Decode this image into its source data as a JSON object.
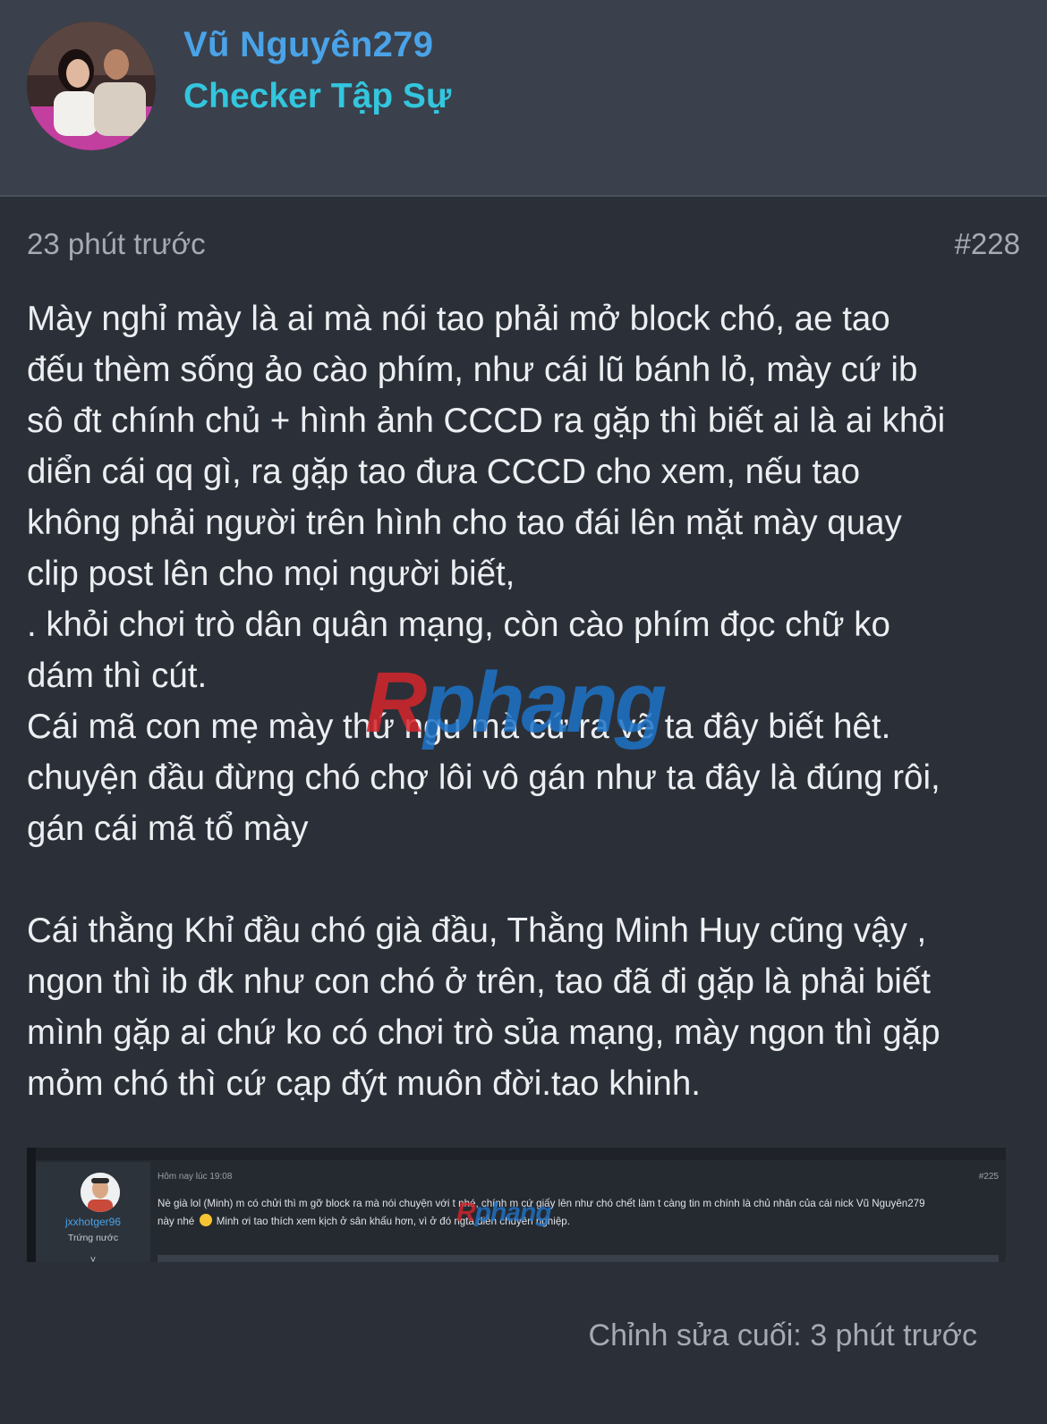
{
  "header": {
    "username": "Vũ Nguyên279",
    "user_title": "Checker Tập Sự"
  },
  "post": {
    "time": "23 phút trước",
    "number": "#228",
    "lines": [
      "Mày nghỉ mày là ai mà nói tao phải mở block chó, ae tao",
      "đếu thèm sống ảo cào phím, như cái lũ bánh lỏ, mày cứ ib",
      "sô đt chính chủ + hình ảnh CCCD ra gặp thì biết ai là ai khỏi",
      "diển cái qq gì, ra gặp tao đưa CCCD cho xem, nếu tao",
      "không phải người trên hình cho tao đái lên mặt mày quay",
      "clip post lên cho mọi người biết,",
      ". khỏi chơi trò dân quân mạng, còn cào phím đọc chữ ko",
      "dám thì cút.",
      "Cái mã con mẹ mày thứ ngu mà cứ ra vẽ ta đây biết hêt.",
      "chuyện đầu đừng chó chợ lôi vô gán như ta đây là đúng rôi,",
      "gán cái mã tổ mày"
    ],
    "lines2": [
      "Cái thằng Khỉ đầu chó già đầu, Thằng Minh Huy cũng vậy ,",
      "ngon thì ib đk như con chó ở trên, tao đã đi gặp là phải biết",
      "mình gặp ai chứ ko có chơi trò sủa mạng, mày ngon thì gặp",
      "mỏm chó thì cứ cạp đýt muôn đời.tao khinh."
    ],
    "edited": "Chỉnh sửa cuối: 3 phút trước"
  },
  "watermark": {
    "first": "R",
    "rest": "phang"
  },
  "quote": {
    "username": "jxxhotger96",
    "user_title": "Trứng nước",
    "time": "Hôm nay lúc 19:08",
    "number": "#225",
    "line1": "Nè già lol (Minh) m có chửi thì m gỡ block ra mà nói chuyện với t nhé, chính m cứ giấy lên như chó chết làm t càng tin m chính là chủ nhân của cái nick Vũ Nguyên279",
    "line2a": "này nhé",
    "line2b": "Minh ơi tao thích xem kịch ở sân khấu hơn, vì ở đó ngta diễn chuyên nghiệp.",
    "emoji": "smiley-emoji",
    "chevron": "˅"
  },
  "colors": {
    "background": "#2b3038",
    "header": "#3a414c",
    "username": "#4aa3e8",
    "user_title": "#33c6de",
    "watermark_red": "#d6252c",
    "watermark_blue": "#1e74c9"
  }
}
